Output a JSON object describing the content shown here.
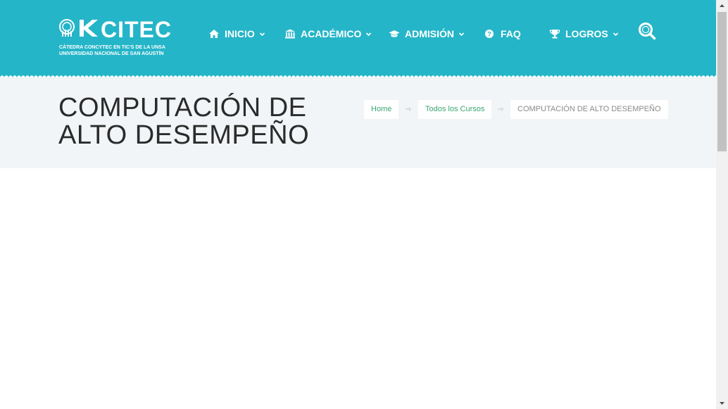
{
  "logo": {
    "word": "CITEC",
    "subtitle_line1": "CÁTEDRA CONCYTEC EN TIC'S DE LA UNSA",
    "subtitle_line2": "UNIVERSIDAD NACIONAL DE SAN AGUSTÍN"
  },
  "nav": {
    "items": [
      {
        "label": "INICIO",
        "icon": "home-icon",
        "has_dropdown": true
      },
      {
        "label": "ACADÉMICO",
        "icon": "institution-icon",
        "has_dropdown": true
      },
      {
        "label": "ADMISIÓN",
        "icon": "graduation-cap-icon",
        "has_dropdown": true
      },
      {
        "label": "FAQ",
        "icon": "question-circle-icon",
        "has_dropdown": false
      },
      {
        "label": "LOGROS",
        "icon": "trophy-icon",
        "has_dropdown": true
      }
    ],
    "search_icon": "search-icon"
  },
  "page": {
    "title": "COMPUTACIÓN DE ALTO DESEMPEÑO"
  },
  "breadcrumb": {
    "home": "Home",
    "courses": "Todos los Cursos",
    "current": "COMPUTACIÓN DE ALTO DESEMPEÑO"
  },
  "colors": {
    "header": "#25b5c8",
    "band": "#f2f5f7",
    "breadcrumb_link": "#3aa672"
  }
}
